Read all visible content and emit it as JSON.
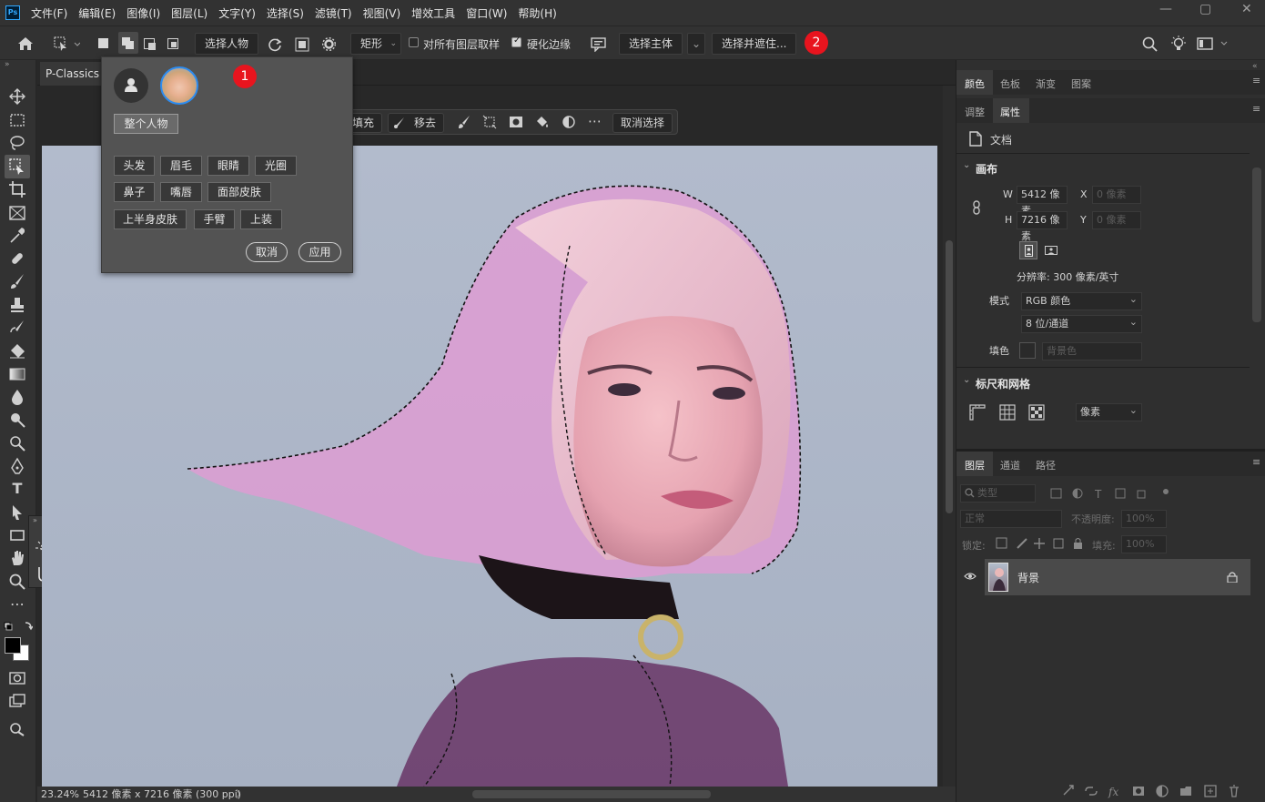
{
  "app": {
    "logo_text": "Ps"
  },
  "menu": [
    "文件(F)",
    "编辑(E)",
    "图像(I)",
    "图层(L)",
    "文字(Y)",
    "选择(S)",
    "滤镜(T)",
    "视图(V)",
    "增效工具",
    "窗口(W)",
    "帮助(H)"
  ],
  "window_controls": {
    "minimize": "—",
    "maximize": "▢",
    "close": "✕"
  },
  "options_bar": {
    "select_person": "选择人物",
    "shape_mode": "矩形",
    "sample_all_layers": "对所有图层取样",
    "sample_all_checked": false,
    "harden_edge": "硬化边缘",
    "harden_edge_checked": true,
    "select_subject": "选择主体",
    "select_and_mask": "选择并遮住...",
    "badge": "2"
  },
  "document": {
    "tab_title": "P-Classics R",
    "zoom": "23.24%",
    "info": "5412 像素 x 7216 像素 (300 ppi)",
    "arrow": "〉"
  },
  "taskbar": {
    "fill": "填充",
    "remove": "移去",
    "deselect": "取消选择"
  },
  "popup": {
    "badge": "1",
    "whole_person": "整个人物",
    "parts": [
      [
        "头发",
        "眉毛",
        "眼睛",
        "光圈"
      ],
      [
        "鼻子",
        "嘴唇",
        "面部皮肤"
      ],
      [
        "上半身皮肤",
        "手臂",
        "上装"
      ]
    ],
    "cancel": "取消",
    "apply": "应用"
  },
  "top_panel": {
    "tabs": [
      "颜色",
      "色板",
      "渐变",
      "图案"
    ],
    "active": "颜色"
  },
  "props_panel": {
    "tabs": [
      "调整",
      "属性"
    ],
    "active": "属性",
    "doc_label": "文档",
    "canvas_section": "画布",
    "w_label": "W",
    "w_value": "5412 像素",
    "h_label": "H",
    "h_value": "7216 像素",
    "x_label": "X",
    "x_value": "0 像素",
    "y_label": "Y",
    "y_value": "0 像素",
    "resolution": "分辨率: 300 像素/英寸",
    "mode_label": "模式",
    "mode_value": "RGB 颜色",
    "bits_value": "8 位/通道",
    "fill_label": "填色",
    "fill_value": "背景色",
    "rulers_section": "标尺和网格",
    "units_value": "像素"
  },
  "layers_panel": {
    "tabs": [
      "图层",
      "通道",
      "路径"
    ],
    "active": "图层",
    "filter_placeholder": "类型",
    "blend_mode": "正常",
    "opacity_label": "不透明度:",
    "opacity_value": "100%",
    "lock_label": "锁定:",
    "fill_label": "填充:",
    "fill_value": "100%",
    "layers": [
      {
        "name": "背景",
        "locked": true,
        "visible": true
      }
    ]
  },
  "colors": {
    "accent_badge": "#e8141e",
    "mask_pink": "#e49ad4"
  }
}
